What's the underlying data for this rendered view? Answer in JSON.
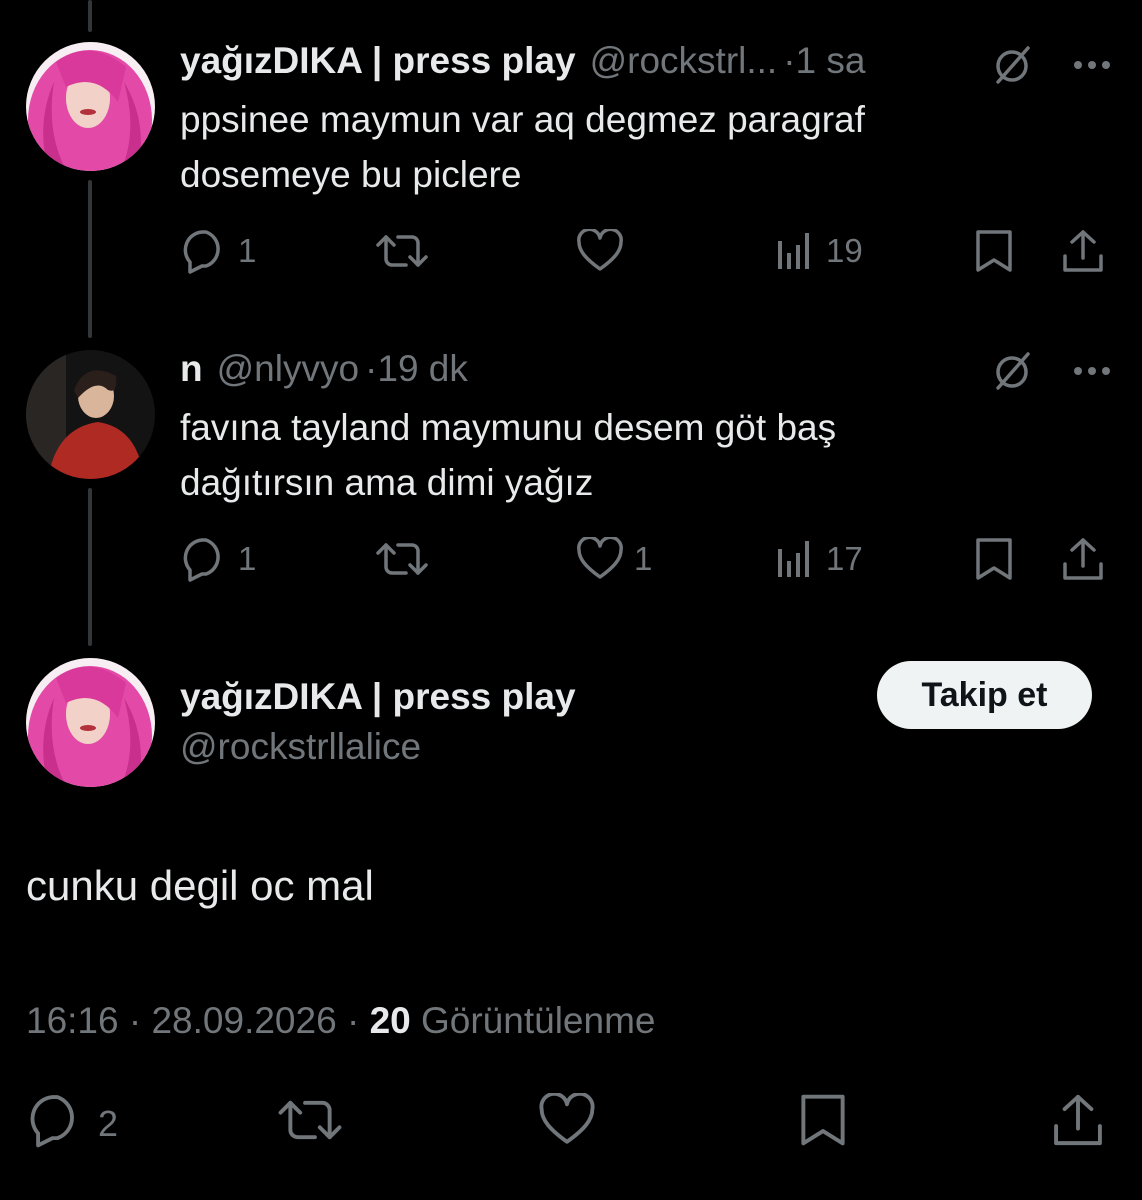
{
  "tweets": [
    {
      "name": "yağızDIKA | press play",
      "handle": "@rockstrl...",
      "sep": "·",
      "time": "1 sa",
      "text_lines": [
        "ppsinee maymun var aq degmez paragraf",
        "dosemeye bu piclere"
      ],
      "replies": "1",
      "retweets": "",
      "likes": "",
      "views": "19",
      "avatar_desc": "pink-haired-avatar"
    },
    {
      "name": "n",
      "handle": "@nlyvyo",
      "sep": "·",
      "time": "19 dk",
      "text_lines": [
        "favına tayland maymunu desem göt baş",
        "dağıtırsın ama dimi yağız"
      ],
      "replies": "1",
      "retweets": "",
      "likes": "1",
      "views": "17",
      "avatar_desc": "person-red-shirt-avatar"
    }
  ],
  "main_tweet": {
    "name": "yağızDIKA | press play",
    "handle": "@rockstrllalice",
    "follow_label": "Takip et",
    "text": "cunku degil oc mal",
    "time": "16:16",
    "date": "28.09.2026",
    "sep": "·",
    "views_count": "20",
    "views_label": "Görüntülenme",
    "replies": "2"
  },
  "icons": {
    "grok": "grok-icon",
    "more": "more-icon",
    "reply": "reply-icon",
    "retweet": "retweet-icon",
    "like": "like-icon",
    "views": "views-icon",
    "bookmark": "bookmark-icon",
    "share": "share-icon"
  },
  "colors": {
    "background": "#000000",
    "text": "#e7e9ea",
    "secondary": "#71767b",
    "thread_line": "#333639",
    "follow_bg": "#eff3f4"
  }
}
